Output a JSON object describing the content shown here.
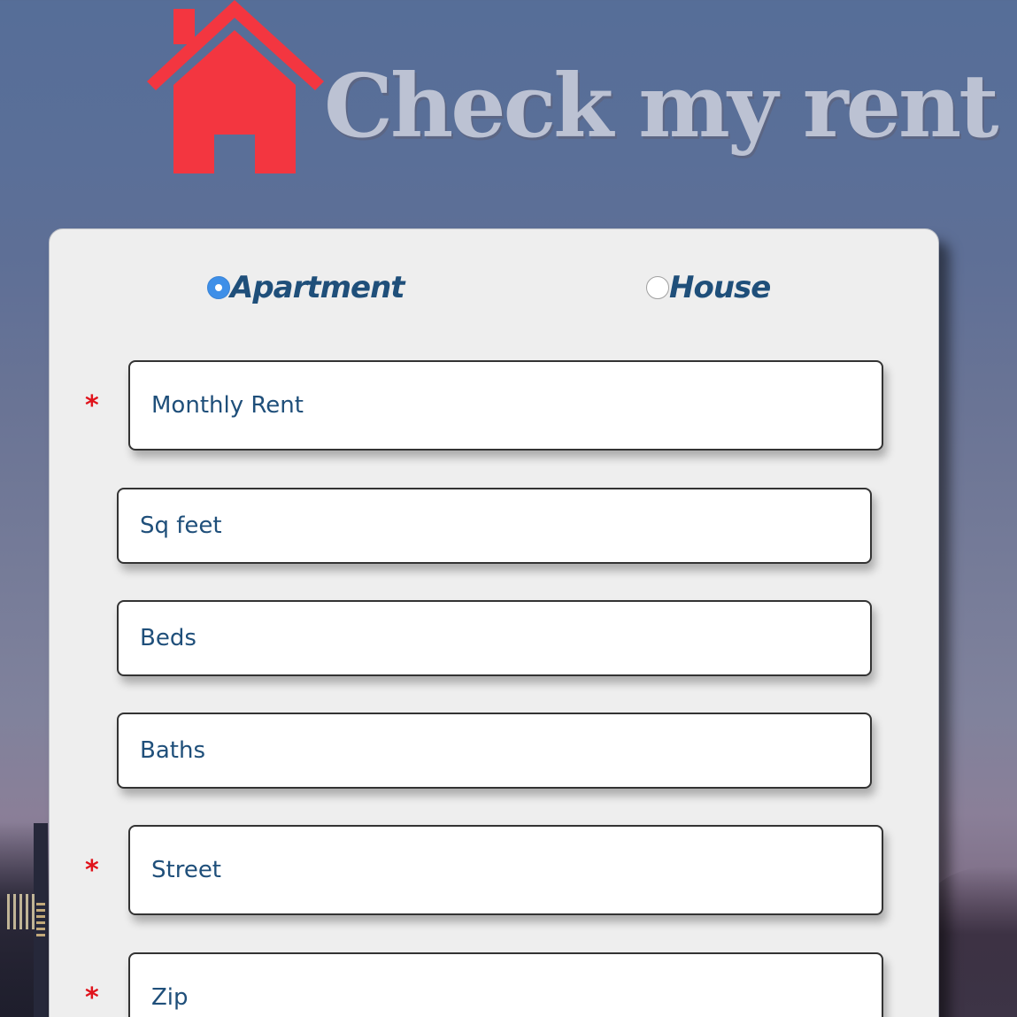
{
  "header": {
    "title": "Check my rent",
    "logo_icon": "house-icon",
    "logo_color": "#f33640"
  },
  "property_type": {
    "options": [
      {
        "label": "Apartment",
        "checked": true
      },
      {
        "label": "House",
        "checked": false
      }
    ]
  },
  "form": {
    "required_marker": "*",
    "fields": {
      "monthly_rent": {
        "placeholder": "Monthly Rent",
        "required": true
      },
      "sq_feet": {
        "placeholder": "Sq feet",
        "required": false
      },
      "beds": {
        "placeholder": "Beds",
        "required": false
      },
      "baths": {
        "placeholder": "Baths",
        "required": false
      },
      "street": {
        "placeholder": "Street",
        "required": true
      },
      "zip": {
        "placeholder": "Zip",
        "required": true
      }
    }
  },
  "colors": {
    "accent": "#3e8fe8",
    "text": "#1f4f7a",
    "required": "#e0131b",
    "card": "#eeeeee"
  }
}
